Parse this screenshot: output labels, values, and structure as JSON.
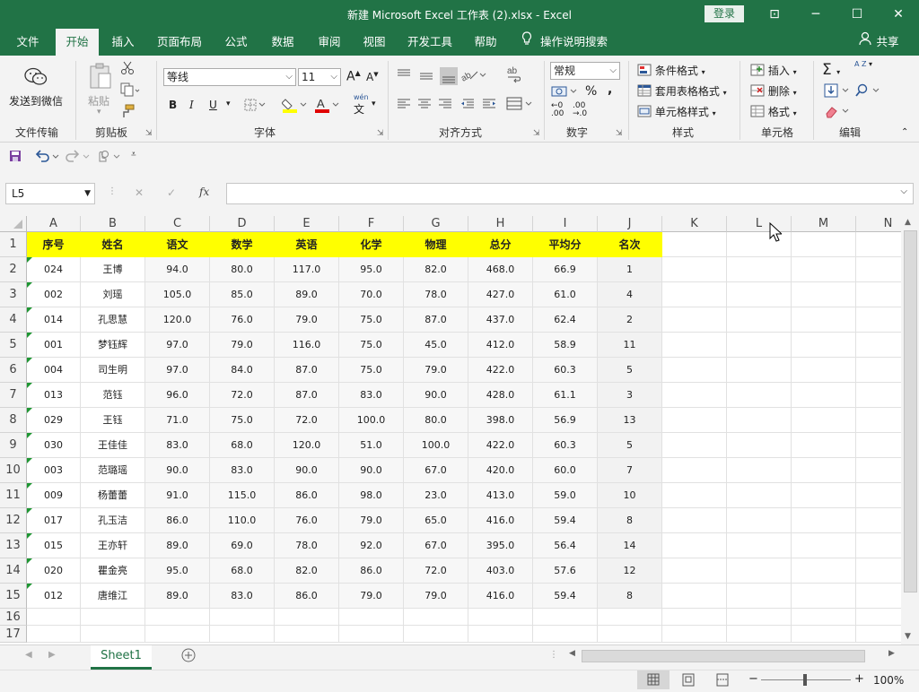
{
  "window": {
    "title": "新建 Microsoft Excel 工作表 (2).xlsx  -  Excel",
    "login_label": "登录",
    "min_glyph": "─",
    "max_glyph": "☐",
    "close_glyph": "✕",
    "restore_ribbon_glyph": "⊡"
  },
  "ribbon_tabs": [
    "文件",
    "开始",
    "插入",
    "页面布局",
    "公式",
    "数据",
    "审阅",
    "视图",
    "开发工具",
    "帮助"
  ],
  "tell_me": "操作说明搜索",
  "share": "共享",
  "ribbon": {
    "send_wechat": "发送到微信",
    "paste": "粘贴",
    "font_name": "等线",
    "font_size": "11",
    "bold": "B",
    "italic": "I",
    "underline": "U",
    "grow_font": "A",
    "shrink_font": "A",
    "wen_label": "wén",
    "wen_char": "文",
    "number_format": "常规",
    "percent": "%",
    "comma": ",",
    "dec_increase_a": "←0",
    "dec_increase_b": ".00",
    "dec_decrease_a": ".00",
    "dec_decrease_b": "→.0",
    "cond_format": "条件格式",
    "table_format": "套用表格格式",
    "cell_style": "单元格样式",
    "insert": "插入",
    "delete": "删除",
    "format": "格式",
    "sigma": "Σ",
    "az": "A Z",
    "groups": [
      "文件传输",
      "剪贴板",
      "字体",
      "对齐方式",
      "数字",
      "样式",
      "单元格",
      "编辑"
    ],
    "accent": "#217346"
  },
  "namebox": "L5",
  "formula_icons": [
    "✕",
    "✓",
    "fx"
  ],
  "columns": [
    "A",
    "B",
    "C",
    "D",
    "E",
    "F",
    "G",
    "H",
    "I",
    "J",
    "K",
    "L",
    "M",
    "N"
  ],
  "rows": [
    "1",
    "2",
    "3",
    "4",
    "5",
    "6",
    "7",
    "8",
    "9",
    "10",
    "11",
    "12",
    "13",
    "14",
    "15",
    "16",
    "17"
  ],
  "table": {
    "headers": [
      "序号",
      "姓名",
      "语文",
      "数学",
      "英语",
      "化学",
      "物理",
      "总分",
      "平均分",
      "名次"
    ],
    "data": [
      [
        "024",
        "王博",
        "94.0",
        "80.0",
        "117.0",
        "95.0",
        "82.0",
        "468.0",
        "66.9",
        "1"
      ],
      [
        "002",
        "刘瑶",
        "105.0",
        "85.0",
        "89.0",
        "70.0",
        "78.0",
        "427.0",
        "61.0",
        "4"
      ],
      [
        "014",
        "孔思慧",
        "120.0",
        "76.0",
        "79.0",
        "75.0",
        "87.0",
        "437.0",
        "62.4",
        "2"
      ],
      [
        "001",
        "梦钰辉",
        "97.0",
        "79.0",
        "116.0",
        "75.0",
        "45.0",
        "412.0",
        "58.9",
        "11"
      ],
      [
        "004",
        "司生明",
        "97.0",
        "84.0",
        "87.0",
        "75.0",
        "79.0",
        "422.0",
        "60.3",
        "5"
      ],
      [
        "013",
        "范钰",
        "96.0",
        "72.0",
        "87.0",
        "83.0",
        "90.0",
        "428.0",
        "61.1",
        "3"
      ],
      [
        "029",
        "王钰",
        "71.0",
        "75.0",
        "72.0",
        "100.0",
        "80.0",
        "398.0",
        "56.9",
        "13"
      ],
      [
        "030",
        "王佳佳",
        "83.0",
        "68.0",
        "120.0",
        "51.0",
        "100.0",
        "422.0",
        "60.3",
        "5"
      ],
      [
        "003",
        "范璐瑶",
        "90.0",
        "83.0",
        "90.0",
        "90.0",
        "67.0",
        "420.0",
        "60.0",
        "7"
      ],
      [
        "009",
        "杨蕾蕾",
        "91.0",
        "115.0",
        "86.0",
        "98.0",
        "23.0",
        "413.0",
        "59.0",
        "10"
      ],
      [
        "017",
        "孔玉洁",
        "86.0",
        "110.0",
        "76.0",
        "79.0",
        "65.0",
        "416.0",
        "59.4",
        "8"
      ],
      [
        "015",
        "王亦轩",
        "89.0",
        "69.0",
        "78.0",
        "92.0",
        "67.0",
        "395.0",
        "56.4",
        "14"
      ],
      [
        "020",
        "瞿金亮",
        "95.0",
        "68.0",
        "82.0",
        "86.0",
        "72.0",
        "403.0",
        "57.6",
        "12"
      ],
      [
        "012",
        "唐维江",
        "89.0",
        "83.0",
        "86.0",
        "79.0",
        "79.0",
        "416.0",
        "59.4",
        "8"
      ]
    ]
  },
  "sheets": [
    "Sheet1"
  ],
  "zoom": "100%",
  "status_minus": "−",
  "status_plus": "+"
}
